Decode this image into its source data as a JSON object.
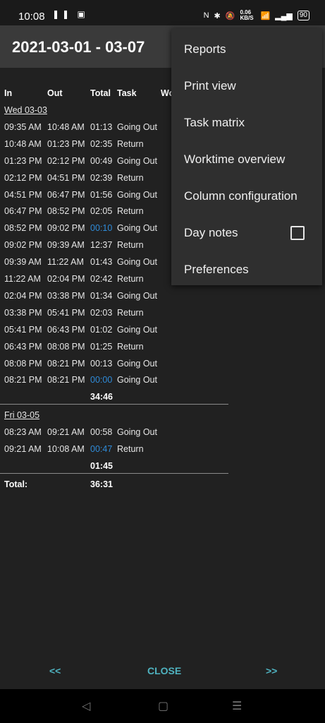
{
  "status": {
    "time": "10:08",
    "left_icons": "❚❚ ▣",
    "right_icons": [
      "N",
      "✱",
      "🔕",
      "0.06 KB/S",
      "📶",
      "▂▄▆"
    ],
    "battery": "90"
  },
  "appbar": {
    "title": "2021-03-01 - 03-07"
  },
  "table": {
    "headers": {
      "in": "In",
      "out": "Out",
      "total": "Total",
      "task": "Task",
      "wo": "Wo"
    },
    "days": [
      {
        "label": "Wed 03-03",
        "rows": [
          {
            "in": "09:35 AM",
            "out": "10:48 AM",
            "total": "01:13",
            "task": "Going Out",
            "highlight": false
          },
          {
            "in": "10:48 AM",
            "out": "01:23 PM",
            "total": "02:35",
            "task": "Return",
            "highlight": false
          },
          {
            "in": "01:23 PM",
            "out": "02:12 PM",
            "total": "00:49",
            "task": "Going Out",
            "highlight": false
          },
          {
            "in": "02:12 PM",
            "out": "04:51 PM",
            "total": "02:39",
            "task": "Return",
            "highlight": false
          },
          {
            "in": "04:51 PM",
            "out": "06:47 PM",
            "total": "01:56",
            "task": "Going Out",
            "highlight": false
          },
          {
            "in": "06:47 PM",
            "out": "08:52 PM",
            "total": "02:05",
            "task": "Return",
            "highlight": false
          },
          {
            "in": "08:52 PM",
            "out": "09:02 PM",
            "total": "00:10",
            "task": "Going Out",
            "highlight": true
          },
          {
            "in": "09:02 PM",
            "out": "09:39 AM",
            "total": "12:37",
            "task": "Return",
            "highlight": false
          },
          {
            "in": "09:39 AM",
            "out": "11:22 AM",
            "total": "01:43",
            "task": "Going Out",
            "highlight": false
          },
          {
            "in": "11:22 AM",
            "out": "02:04 PM",
            "total": "02:42",
            "task": "Return",
            "highlight": false
          },
          {
            "in": "02:04 PM",
            "out": "03:38 PM",
            "total": "01:34",
            "task": "Going Out",
            "highlight": false
          },
          {
            "in": "03:38 PM",
            "out": "05:41 PM",
            "total": "02:03",
            "task": "Return",
            "highlight": false
          },
          {
            "in": "05:41 PM",
            "out": "06:43 PM",
            "total": "01:02",
            "task": "Going Out",
            "highlight": false
          },
          {
            "in": "06:43 PM",
            "out": "08:08 PM",
            "total": "01:25",
            "task": "Return",
            "highlight": false
          },
          {
            "in": "08:08 PM",
            "out": "08:21 PM",
            "total": "00:13",
            "task": "Going Out",
            "highlight": false
          },
          {
            "in": "08:21 PM",
            "out": "08:21 PM",
            "total": "00:00",
            "task": "Going Out",
            "highlight": true
          }
        ],
        "subtotal": "34:46"
      },
      {
        "label": "Fri 03-05",
        "rows": [
          {
            "in": "08:23 AM",
            "out": "09:21 AM",
            "total": "00:58",
            "task": "Going Out",
            "highlight": false
          },
          {
            "in": "09:21 AM",
            "out": "10:08 AM",
            "total": "00:47",
            "task": "Return",
            "highlight": true
          }
        ],
        "subtotal": "01:45"
      }
    ],
    "total_label": "Total:",
    "total_value": "36:31"
  },
  "menu": {
    "items": [
      {
        "label": "Reports",
        "name": "menu-item-reports"
      },
      {
        "label": "Print view",
        "name": "menu-item-print-view"
      },
      {
        "label": "Task matrix",
        "name": "menu-item-task-matrix"
      },
      {
        "label": "Worktime overview",
        "name": "menu-item-worktime-overview"
      },
      {
        "label": "Column configuration",
        "name": "menu-item-column-configuration"
      },
      {
        "label": "Day notes",
        "name": "menu-item-day-notes",
        "checkbox": true,
        "checked": false
      },
      {
        "label": "Preferences",
        "name": "menu-item-preferences"
      }
    ]
  },
  "footer": {
    "prev": "<<",
    "close": "CLOSE",
    "next": ">>"
  },
  "navbar": {
    "back": "◁",
    "home": "▢",
    "recents": "☰"
  },
  "colors": {
    "highlight": "#2f8bd8",
    "accent": "#4fb3c0"
  }
}
